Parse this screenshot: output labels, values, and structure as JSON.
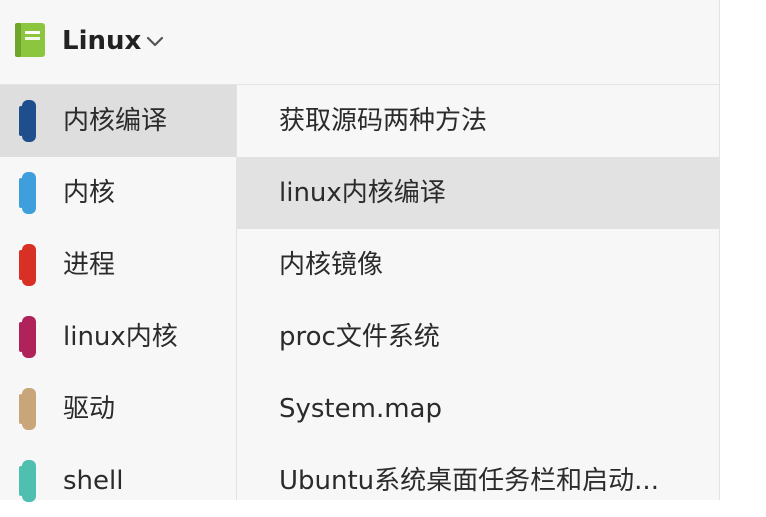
{
  "header": {
    "notebook_title": "Linux",
    "notebook_icon_color": "#8cc63f"
  },
  "sections": [
    {
      "label": "内核编译",
      "color": "#1f4e8c",
      "selected": true
    },
    {
      "label": "内核",
      "color": "#3e9fdc",
      "selected": false
    },
    {
      "label": "进程",
      "color": "#d93025",
      "selected": false
    },
    {
      "label": "linux内核",
      "color": "#b0225a",
      "selected": false
    },
    {
      "label": "驱动",
      "color": "#c9a57a",
      "selected": false
    },
    {
      "label": "shell",
      "color": "#4fc0b0",
      "selected": false
    }
  ],
  "pages": [
    {
      "label": "获取源码两种方法",
      "selected": false
    },
    {
      "label": "linux内核编译",
      "selected": true
    },
    {
      "label": "内核镜像",
      "selected": false
    },
    {
      "label": "proc文件系统",
      "selected": false
    },
    {
      "label": "System.map",
      "selected": false
    },
    {
      "label": "Ubuntu系统桌面任务栏和启动...",
      "selected": false
    }
  ],
  "colors": {
    "selected_section_bg": "#dedede",
    "selected_page_bg": "#e2e2e2",
    "panel_bg": "#f7f7f7"
  }
}
